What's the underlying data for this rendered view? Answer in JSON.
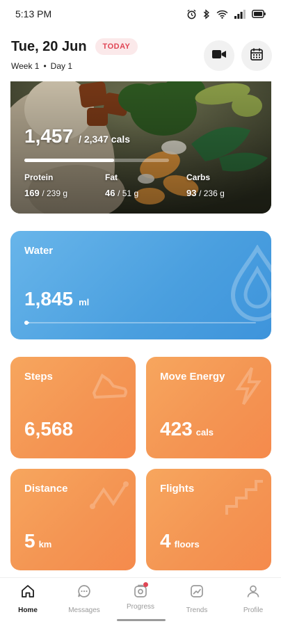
{
  "status_bar": {
    "time": "5:13 PM",
    "icons": [
      "alarm-icon",
      "bluetooth-icon",
      "wifi-icon",
      "signal-icon",
      "battery-icon"
    ]
  },
  "header": {
    "date": "Tue, 20 Jun",
    "today_label": "TODAY",
    "week_label": "Week 1",
    "separator": "•",
    "day_label": "Day 1",
    "video_icon": "video-camera-icon",
    "calendar_icon": "calendar-icon"
  },
  "nutrition": {
    "calories": "1,457",
    "calories_goal": "/ 2,347 cals",
    "progress_fraction": 0.62,
    "macros": [
      {
        "label": "Protein",
        "value": "169",
        "goal": "/ 239 g"
      },
      {
        "label": "Fat",
        "value": "46",
        "goal": "/ 51 g"
      },
      {
        "label": "Carbs",
        "value": "93",
        "goal": "/ 236 g"
      }
    ]
  },
  "water": {
    "title": "Water",
    "value": "1,845",
    "unit": "ml",
    "progress_fraction": 0.02,
    "color": "#4a9fdf"
  },
  "tiles": {
    "steps": {
      "title": "Steps",
      "value": "6,568",
      "unit": ""
    },
    "move": {
      "title": "Move Energy",
      "value": "423",
      "unit": "cals"
    },
    "distance": {
      "title": "Distance",
      "value": "5",
      "unit": "km"
    },
    "flights": {
      "title": "Flights",
      "value": "4",
      "unit": "floors"
    },
    "color": "#f49553"
  },
  "tabbar": {
    "items": [
      {
        "label": "Home",
        "icon": "home-icon",
        "active": true
      },
      {
        "label": "Messages",
        "icon": "chat-bubble-icon",
        "active": false
      },
      {
        "label": "Progress",
        "icon": "progress-icon",
        "active": false
      },
      {
        "label": "Trends",
        "icon": "trends-icon",
        "active": false
      },
      {
        "label": "Profile",
        "icon": "person-icon",
        "active": false
      }
    ]
  }
}
